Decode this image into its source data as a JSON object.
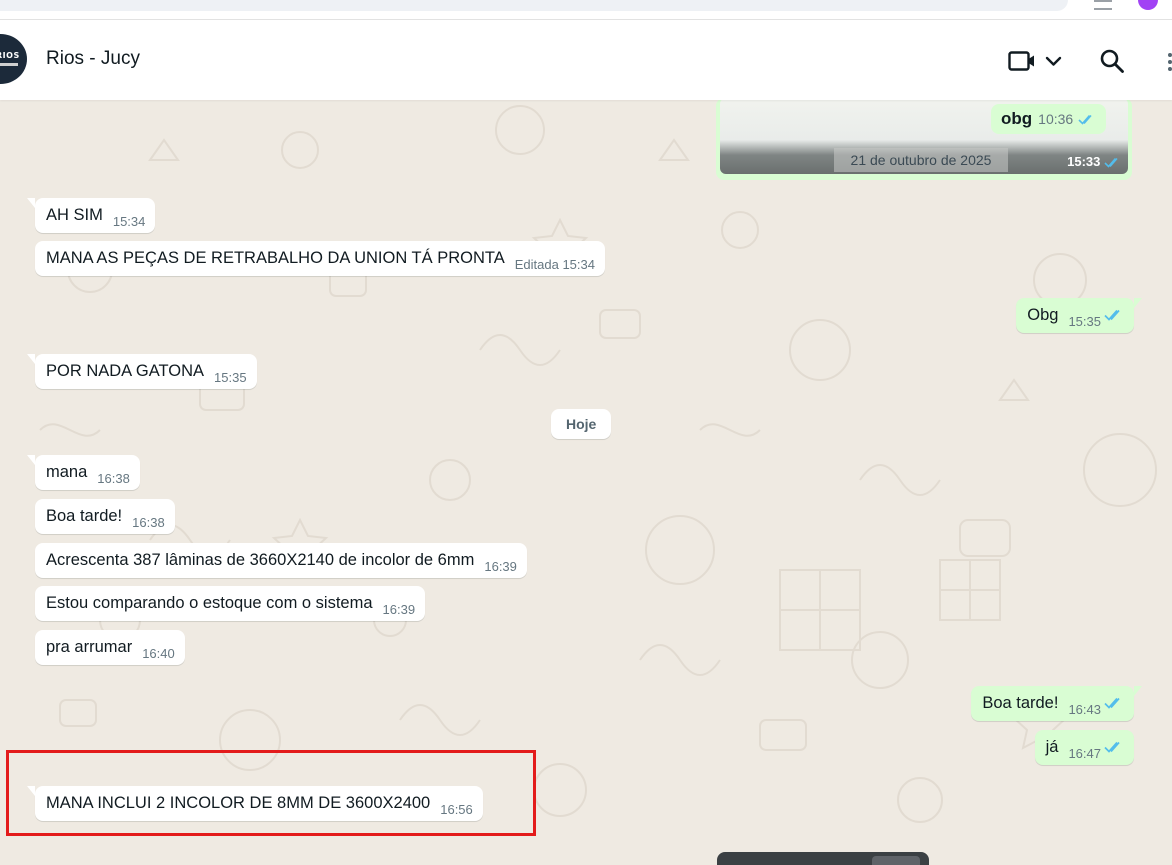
{
  "contact": {
    "name": "Rios - Jucy",
    "avatar_text": "RIOS"
  },
  "header_icons": [
    "video-call-icon",
    "chevron-down-icon",
    "search-icon",
    "menu-icon"
  ],
  "media": {
    "reply_text": "obg",
    "reply_time": "10:36",
    "date_label": "21 de outubro de 2025",
    "time": "15:33"
  },
  "day_separator": "Hoje",
  "messages": [
    {
      "dir": "in",
      "text": "AH SIM",
      "time": "15:34"
    },
    {
      "dir": "in",
      "text": "MANA AS PEÇAS DE RETRABALHO DA UNION TÁ PRONTA",
      "time": "Editada 15:34"
    },
    {
      "dir": "out",
      "text": "Obg",
      "time": "15:35"
    },
    {
      "dir": "in",
      "text": "POR NADA GATONA",
      "time": "15:35"
    },
    {
      "dir": "in",
      "text": "mana",
      "time": "16:38"
    },
    {
      "dir": "in",
      "text": "Boa tarde!",
      "time": "16:38"
    },
    {
      "dir": "in",
      "text": "Acrescenta 387 lâminas de 3660X2140 de incolor de 6mm",
      "time": "16:39"
    },
    {
      "dir": "in",
      "text": "Estou comparando o estoque com o sistema",
      "time": "16:39"
    },
    {
      "dir": "in",
      "text": "pra arrumar",
      "time": "16:40"
    },
    {
      "dir": "out",
      "text": "Boa tarde!",
      "time": "16:43"
    },
    {
      "dir": "out",
      "text": "já",
      "time": "16:47"
    },
    {
      "dir": "in",
      "text": "MANA INCLUI 2 INCOLOR DE 8MM DE 3600X2400",
      "time": "16:56"
    }
  ],
  "colors": {
    "chat_bg": "#efeae2",
    "incoming": "#ffffff",
    "outgoing": "#d9fdd3",
    "read_ticks": "#53bdeb",
    "highlight": "#e31b1b"
  }
}
